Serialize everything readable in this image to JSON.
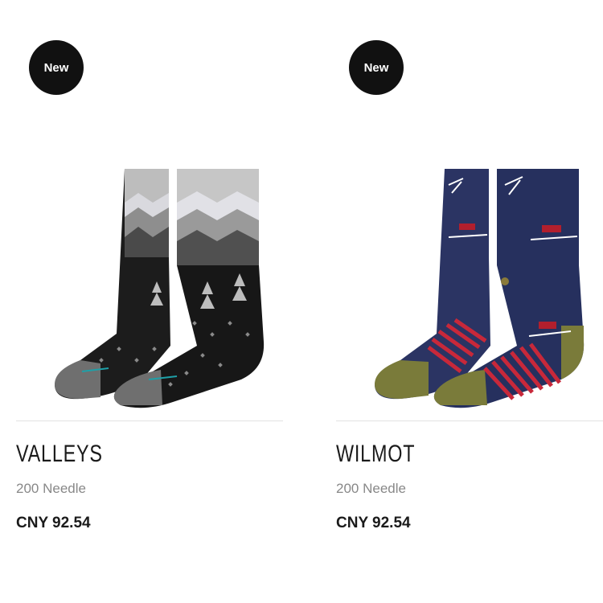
{
  "products": [
    {
      "badge": "New",
      "name": "VALLEYS",
      "subtitle": "200 Needle",
      "price": "CNY 92.54",
      "image_icon": "valleys-sock-pair"
    },
    {
      "badge": "New",
      "name": "WILMOT",
      "subtitle": "200 Needle",
      "price": "CNY 92.54",
      "image_icon": "wilmot-sock-pair"
    }
  ],
  "colors": {
    "badge_bg": "#111111",
    "text_primary": "#1a1a1a",
    "text_secondary": "#888888",
    "divider": "#e2e2e2"
  }
}
